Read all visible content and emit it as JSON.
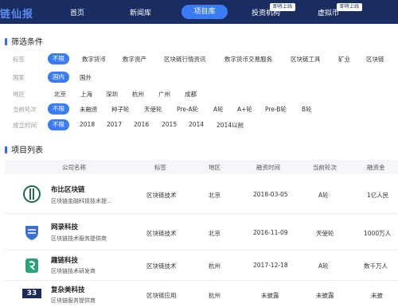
{
  "nav": {
    "logo": "链仙报",
    "items": [
      "首页",
      "新闻库",
      "项目库",
      "投资机构",
      "虚拟币"
    ],
    "active": "项目库",
    "tags": [
      "即将上线",
      "即将上线"
    ]
  },
  "filters": {
    "title": "筛选条件",
    "rows": [
      {
        "label": "标签",
        "options": [
          "不限",
          "数字货币",
          "数字资产",
          "区块链行情资讯",
          "数字货币交易服务",
          "区块链工具",
          "矿业",
          "区块链"
        ],
        "selected": 0
      },
      {
        "label": "国家",
        "options": [
          "国内",
          "国外"
        ],
        "selected": 0
      },
      {
        "label": "地区",
        "options": [
          "北京",
          "上海",
          "深圳",
          "杭州",
          "广州",
          "成都"
        ],
        "selected": -1
      },
      {
        "label": "当前轮次",
        "options": [
          "不限",
          "未融资",
          "种子轮",
          "天使轮",
          "Pre-A轮",
          "A轮",
          "A+轮",
          "Pre-B轮",
          "B轮"
        ],
        "selected": 0
      },
      {
        "label": "成立时间",
        "options": [
          "不限",
          "2018",
          "2017",
          "2016",
          "2015",
          "2014",
          "2014以前"
        ],
        "selected": 0
      }
    ]
  },
  "list": {
    "title": "项目列表",
    "headers": [
      "公司名称",
      "标签",
      "地区",
      "融资时间",
      "当前轮次",
      "融资金"
    ],
    "rows": [
      {
        "name": "布比区块链",
        "desc": "区块链金融科技技术提...",
        "tag": "区块链技术",
        "region": "北京",
        "date": "2018-03-05",
        "round": "A轮",
        "amount": "1亿人民",
        "logo": "bubi-logo"
      },
      {
        "name": "网录科技",
        "desc": "区块链技术服务提供商",
        "tag": "区块链技术",
        "region": "北京",
        "date": "2016-11-09",
        "round": "天使轮",
        "amount": "1000万人",
        "logo": "wanglu-logo"
      },
      {
        "name": "趣链科技",
        "desc": "区块链技术研发商",
        "tag": "区块链技术",
        "region": "杭州",
        "date": "2017-12-18",
        "round": "A轮",
        "amount": "数千万人",
        "logo": "qulian-logo"
      },
      {
        "name": "复杂美科技",
        "desc": "区块链服务提供商",
        "tag": "区块链应用",
        "region": "杭州",
        "date": "未披露",
        "round": "未披露",
        "amount": "未披",
        "logo": "fuzamei-logo",
        "logo_text": "33"
      }
    ]
  }
}
